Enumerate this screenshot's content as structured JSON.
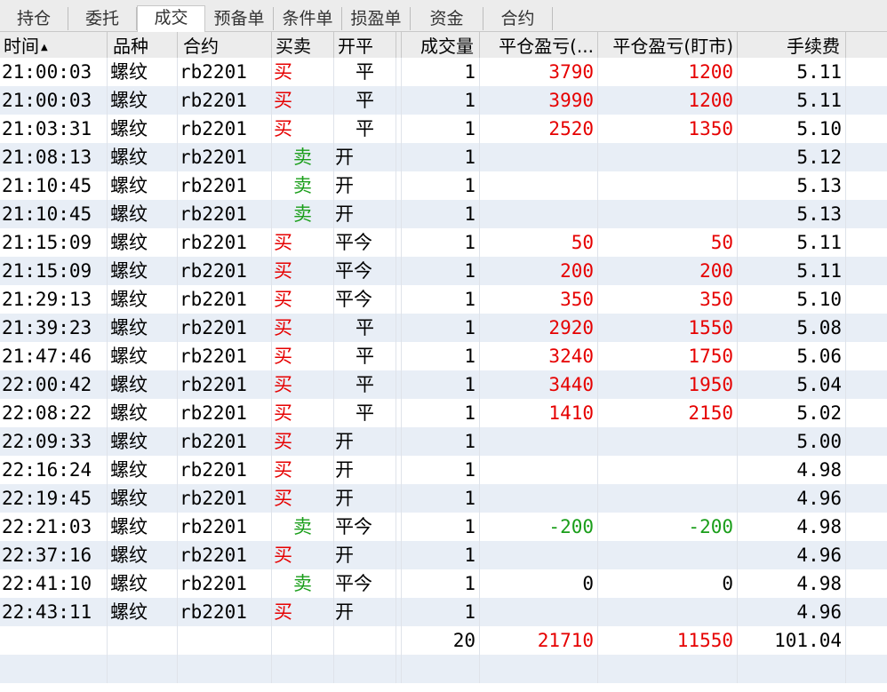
{
  "tabs": [
    {
      "label": "持仓",
      "active": false
    },
    {
      "label": "委托",
      "active": false
    },
    {
      "label": "成交",
      "active": true
    },
    {
      "label": "预备单",
      "active": false
    },
    {
      "label": "条件单",
      "active": false
    },
    {
      "label": "损盈单",
      "active": false
    },
    {
      "label": "资金",
      "active": false
    },
    {
      "label": "合约",
      "active": false
    }
  ],
  "table": {
    "columns": [
      "时间",
      "品种",
      "合约",
      "买卖",
      "开平",
      "",
      "成交量",
      "平仓盈亏(...",
      "平仓盈亏(盯市)",
      "手续费"
    ],
    "sort_icon": "▲",
    "rows": [
      {
        "time": "21:00:03",
        "product": "螺纹",
        "contract": "rb2201",
        "side": "买",
        "offset": "平",
        "cut": "",
        "qty": "1",
        "pnl": "3790",
        "pnl_mtm": "1200",
        "fee": "5.11"
      },
      {
        "time": "21:00:03",
        "product": "螺纹",
        "contract": "rb2201",
        "side": "买",
        "offset": "平",
        "cut": "",
        "qty": "1",
        "pnl": "3990",
        "pnl_mtm": "1200",
        "fee": "5.11"
      },
      {
        "time": "21:03:31",
        "product": "螺纹",
        "contract": "rb2201",
        "side": "买",
        "offset": "平",
        "cut": "",
        "qty": "1",
        "pnl": "2520",
        "pnl_mtm": "1350",
        "fee": "5.10"
      },
      {
        "time": "21:08:13",
        "product": "螺纹",
        "contract": "rb2201",
        "side": "卖",
        "offset": "开",
        "cut": "",
        "qty": "1",
        "pnl": "",
        "pnl_mtm": "",
        "fee": "5.12"
      },
      {
        "time": "21:10:45",
        "product": "螺纹",
        "contract": "rb2201",
        "side": "卖",
        "offset": "开",
        "cut": "",
        "qty": "1",
        "pnl": "",
        "pnl_mtm": "",
        "fee": "5.13"
      },
      {
        "time": "21:10:45",
        "product": "螺纹",
        "contract": "rb2201",
        "side": "卖",
        "offset": "开",
        "cut": "",
        "qty": "1",
        "pnl": "",
        "pnl_mtm": "",
        "fee": "5.13"
      },
      {
        "time": "21:15:09",
        "product": "螺纹",
        "contract": "rb2201",
        "side": "买",
        "offset": "平今",
        "cut": "",
        "qty": "1",
        "pnl": "50",
        "pnl_mtm": "50",
        "fee": "5.11"
      },
      {
        "time": "21:15:09",
        "product": "螺纹",
        "contract": "rb2201",
        "side": "买",
        "offset": "平今",
        "cut": "",
        "qty": "1",
        "pnl": "200",
        "pnl_mtm": "200",
        "fee": "5.11"
      },
      {
        "time": "21:29:13",
        "product": "螺纹",
        "contract": "rb2201",
        "side": "买",
        "offset": "平今",
        "cut": "",
        "qty": "1",
        "pnl": "350",
        "pnl_mtm": "350",
        "fee": "5.10"
      },
      {
        "time": "21:39:23",
        "product": "螺纹",
        "contract": "rb2201",
        "side": "买",
        "offset": "平",
        "cut": "",
        "qty": "1",
        "pnl": "2920",
        "pnl_mtm": "1550",
        "fee": "5.08"
      },
      {
        "time": "21:47:46",
        "product": "螺纹",
        "contract": "rb2201",
        "side": "买",
        "offset": "平",
        "cut": "",
        "qty": "1",
        "pnl": "3240",
        "pnl_mtm": "1750",
        "fee": "5.06"
      },
      {
        "time": "22:00:42",
        "product": "螺纹",
        "contract": "rb2201",
        "side": "买",
        "offset": "平",
        "cut": "",
        "qty": "1",
        "pnl": "3440",
        "pnl_mtm": "1950",
        "fee": "5.04"
      },
      {
        "time": "22:08:22",
        "product": "螺纹",
        "contract": "rb2201",
        "side": "买",
        "offset": "平",
        "cut": "",
        "qty": "1",
        "pnl": "1410",
        "pnl_mtm": "2150",
        "fee": "5.02"
      },
      {
        "time": "22:09:33",
        "product": "螺纹",
        "contract": "rb2201",
        "side": "买",
        "offset": "开",
        "cut": "",
        "qty": "1",
        "pnl": "",
        "pnl_mtm": "",
        "fee": "5.00"
      },
      {
        "time": "22:16:24",
        "product": "螺纹",
        "contract": "rb2201",
        "side": "买",
        "offset": "开",
        "cut": "",
        "qty": "1",
        "pnl": "",
        "pnl_mtm": "",
        "fee": "4.98"
      },
      {
        "time": "22:19:45",
        "product": "螺纹",
        "contract": "rb2201",
        "side": "买",
        "offset": "开",
        "cut": "",
        "qty": "1",
        "pnl": "",
        "pnl_mtm": "",
        "fee": "4.96"
      },
      {
        "time": "22:21:03",
        "product": "螺纹",
        "contract": "rb2201",
        "side": "卖",
        "offset": "平今",
        "cut": "",
        "qty": "1",
        "pnl": "-200",
        "pnl_mtm": "-200",
        "fee": "4.98"
      },
      {
        "time": "22:37:16",
        "product": "螺纹",
        "contract": "rb2201",
        "side": "买",
        "offset": "开",
        "cut": "",
        "qty": "1",
        "pnl": "",
        "pnl_mtm": "",
        "fee": "4.96"
      },
      {
        "time": "22:41:10",
        "product": "螺纹",
        "contract": "rb2201",
        "side": "卖",
        "offset": "平今",
        "cut": "",
        "qty": "1",
        "pnl": "0",
        "pnl_mtm": "0",
        "fee": "4.98"
      },
      {
        "time": "22:43:11",
        "product": "螺纹",
        "contract": "rb2201",
        "side": "买",
        "offset": "开",
        "cut": "",
        "qty": "1",
        "pnl": "",
        "pnl_mtm": "",
        "fee": "4.96"
      }
    ],
    "totals": {
      "qty": "20",
      "pnl": "21710",
      "pnl_mtm": "11550",
      "fee": "101.04"
    }
  },
  "colors": {
    "buy": "#e60000",
    "sell": "#1a9e1a",
    "profit": "#e60000",
    "loss": "#1a9e1a",
    "neutral": "#000000",
    "alt_row": "#e8eef6"
  }
}
